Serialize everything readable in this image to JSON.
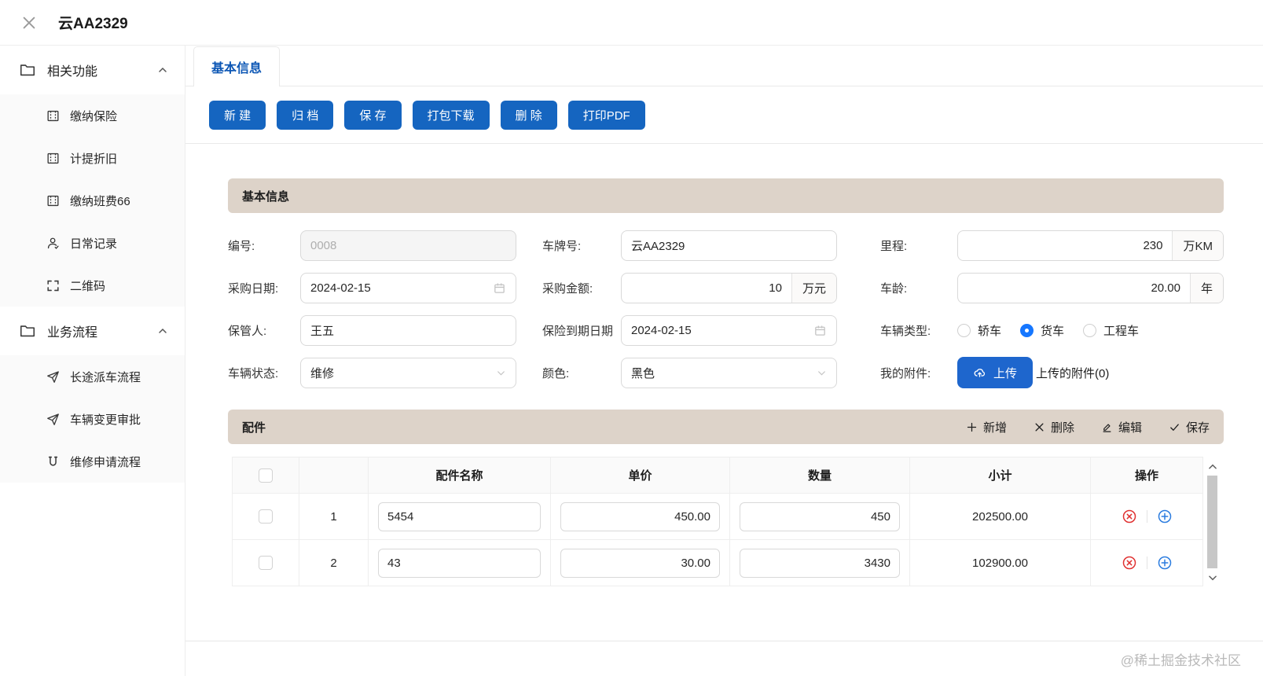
{
  "window": {
    "title": "云AA2329"
  },
  "sidebar": {
    "sections": [
      {
        "label": "相关功能",
        "items": [
          {
            "icon": "form-icon",
            "label": "缴纳保险"
          },
          {
            "icon": "form-icon",
            "label": "计提折旧"
          },
          {
            "icon": "form-icon",
            "label": "缴纳班费66"
          },
          {
            "icon": "user-icon",
            "label": "日常记录"
          },
          {
            "icon": "scan-icon",
            "label": "二维码"
          }
        ]
      },
      {
        "label": "业务流程",
        "items": [
          {
            "icon": "send-icon",
            "label": "长途派车流程"
          },
          {
            "icon": "send-icon",
            "label": "车辆变更审批"
          },
          {
            "icon": "magnet-icon",
            "label": "维修申请流程"
          }
        ]
      }
    ]
  },
  "tabs": [
    {
      "label": "基本信息",
      "active": true
    }
  ],
  "toolbar": {
    "buttons": [
      "新 建",
      "归 档",
      "保 存",
      "打包下载",
      "删 除",
      "打印PDF"
    ]
  },
  "basic_info": {
    "section_title": "基本信息",
    "fields": {
      "number": {
        "label": "编号:",
        "value": "0008",
        "disabled": true
      },
      "plate": {
        "label": "车牌号:",
        "value": "云AA2329"
      },
      "mileage": {
        "label": "里程:",
        "value": "230",
        "unit": "万KM"
      },
      "purchase_date": {
        "label": "采购日期:",
        "value": "2024-02-15"
      },
      "purchase_amt": {
        "label": "采购金额:",
        "value": "10",
        "unit": "万元"
      },
      "vehicle_age": {
        "label": "车龄:",
        "value": "20.00",
        "unit": "年"
      },
      "custodian": {
        "label": "保管人:",
        "value": "王五"
      },
      "ins_expiry": {
        "label": "保险到期日期",
        "value": "2024-02-15"
      },
      "vehicle_type": {
        "label": "车辆类型:",
        "options": [
          "轿车",
          "货车",
          "工程车"
        ],
        "selected": "货车"
      },
      "vehicle_state": {
        "label": "车辆状态:",
        "value": "维修"
      },
      "color": {
        "label": "颜色:",
        "value": "黑色"
      },
      "attachments": {
        "label": "我的附件:",
        "upload_label": "上传",
        "uploaded_text": "上传的附件(0)"
      }
    }
  },
  "parts": {
    "section_title": "配件",
    "actions": [
      {
        "icon": "plus-icon",
        "label": "新增"
      },
      {
        "icon": "close-icon",
        "label": "删除"
      },
      {
        "icon": "edit-icon",
        "label": "编辑"
      },
      {
        "icon": "check-icon",
        "label": "保存"
      }
    ],
    "columns": {
      "name": "配件名称",
      "price": "单价",
      "qty": "数量",
      "subtotal": "小计",
      "ops": "操作"
    },
    "rows": [
      {
        "index": "1",
        "name": "5454",
        "price": "450.00",
        "qty": "450",
        "subtotal": "202500.00"
      },
      {
        "index": "2",
        "name": "43",
        "price": "30.00",
        "qty": "3430",
        "subtotal": "102900.00"
      }
    ]
  },
  "footer": {
    "watermark": "@稀土掘金技术社区"
  },
  "colors": {
    "primary_button": "#1565c0",
    "tab_text": "#0d57b5",
    "radio_checked": "#1677ff",
    "section_bar": "#ddd3c9",
    "delete_icon": "#e03131",
    "add_icon": "#2b7cdf"
  }
}
